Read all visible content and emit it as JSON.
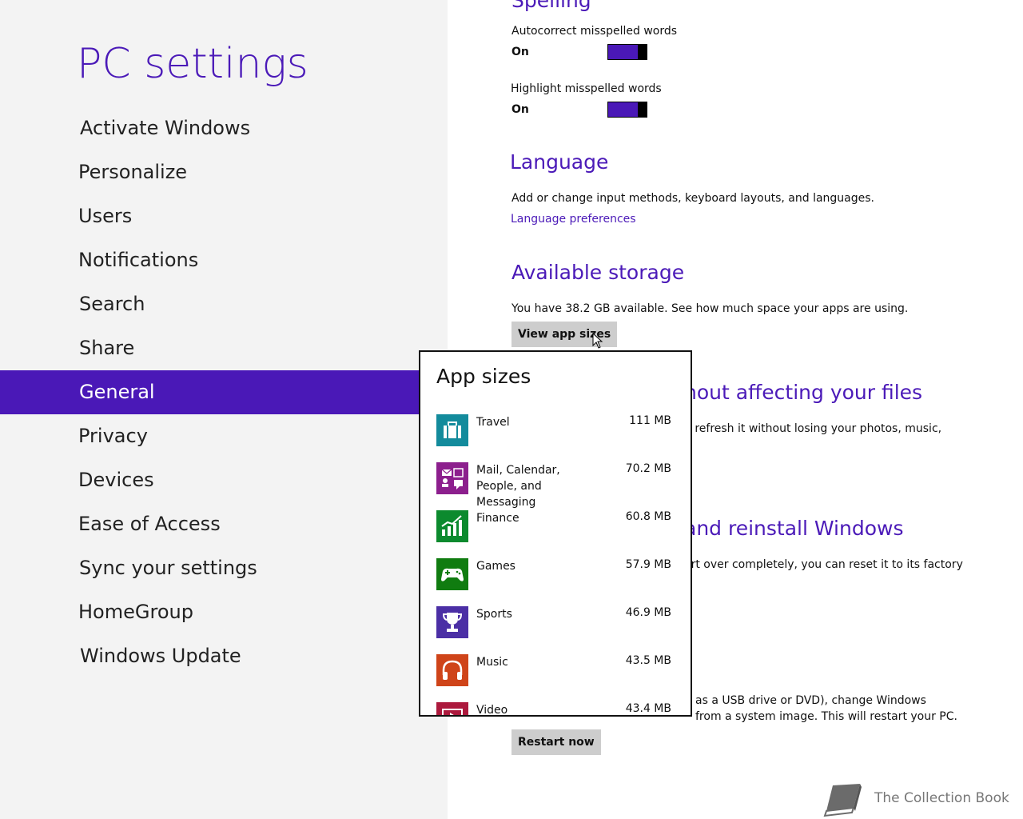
{
  "app_title": "PC settings",
  "nav": [
    {
      "label": "Activate Windows",
      "selected": false
    },
    {
      "label": "Personalize",
      "selected": false
    },
    {
      "label": "Users",
      "selected": false
    },
    {
      "label": "Notifications",
      "selected": false
    },
    {
      "label": "Search",
      "selected": false
    },
    {
      "label": "Share",
      "selected": false
    },
    {
      "label": "General",
      "selected": true
    },
    {
      "label": "Privacy",
      "selected": false
    },
    {
      "label": "Devices",
      "selected": false
    },
    {
      "label": "Ease of Access",
      "selected": false
    },
    {
      "label": "Sync your settings",
      "selected": false
    },
    {
      "label": "HomeGroup",
      "selected": false
    },
    {
      "label": "Windows Update",
      "selected": false
    }
  ],
  "spelling": {
    "title": "Spelling",
    "autocorrect_label": "Autocorrect misspelled words",
    "autocorrect_state": "On",
    "highlight_label": "Highlight misspelled words",
    "highlight_state": "On"
  },
  "language": {
    "title": "Language",
    "description": "Add or change input methods, keyboard layouts, and languages.",
    "link": "Language preferences"
  },
  "storage": {
    "title": "Available storage",
    "description": "You have 38.2 GB available. See how much space your apps are using.",
    "button": "View app sizes"
  },
  "refresh": {
    "title_visible": "hout affecting your files",
    "description_visible": "n refresh it without losing your photos, music,"
  },
  "reset": {
    "title_visible": "and reinstall Windows",
    "description_visible": "art over completely, you can reset it to its factory"
  },
  "advanced": {
    "line1_visible": "as a USB drive or DVD), change Windows",
    "line2_visible": "from a system image. This will restart your PC.",
    "button": "Restart now"
  },
  "app_sizes_popup": {
    "title": "App sizes",
    "apps": [
      {
        "name": "Travel",
        "size": "111 MB",
        "color": "#138b9c",
        "icon": "suitcase-icon"
      },
      {
        "name": "Mail, Calendar, People, and Messaging",
        "size": "70.2 MB",
        "color": "#8c1f8d",
        "icon": "mail-calendar-people-icon"
      },
      {
        "name": "Finance",
        "size": "60.8 MB",
        "color": "#0c8a2e",
        "icon": "chart-icon"
      },
      {
        "name": "Games",
        "size": "57.9 MB",
        "color": "#107c10",
        "icon": "gamepad-icon"
      },
      {
        "name": "Sports",
        "size": "46.9 MB",
        "color": "#4b2fa5",
        "icon": "trophy-icon"
      },
      {
        "name": "Music",
        "size": "43.5 MB",
        "color": "#cf4419",
        "icon": "headphones-icon"
      },
      {
        "name": "Video",
        "size": "43.4 MB",
        "color": "#ac193d",
        "icon": "video-icon"
      }
    ]
  },
  "watermark": "The Collection Book"
}
